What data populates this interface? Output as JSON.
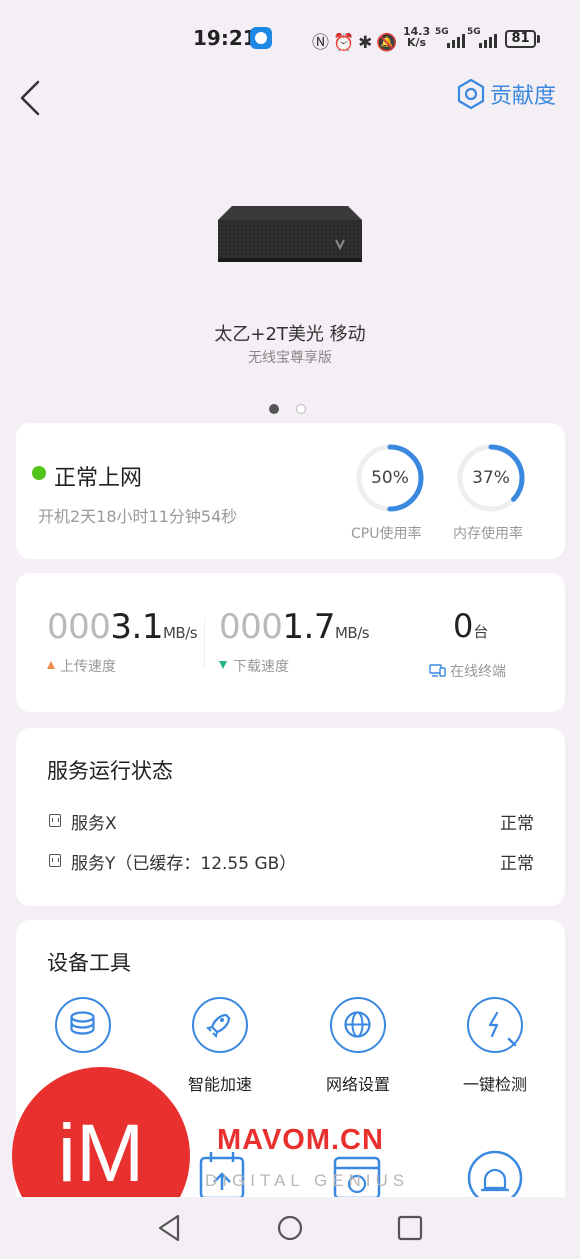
{
  "status_bar": {
    "time": "19:21",
    "net_speed_value": "14.3",
    "net_speed_unit": "K/s",
    "sig1": "5G",
    "sig2": "5G",
    "battery": "81",
    "icons": [
      "nfc-icon",
      "alarm-icon",
      "bluetooth-icon",
      "mute-icon"
    ]
  },
  "header": {
    "contribution_label": "贡献度"
  },
  "device": {
    "name": "太乙+2T美光 移动",
    "subtitle": "无线宝尊享版",
    "carousel_pages": 2,
    "carousel_active": 0
  },
  "status_card": {
    "status_text": "正常上网",
    "uptime": "开机2天18小时11分钟54秒",
    "cpu_value": "50%",
    "cpu_fraction": 0.5,
    "cpu_label": "CPU使用率",
    "mem_value": "37%",
    "mem_fraction": 0.37,
    "mem_label": "内存使用率",
    "accent": "#3a88e0"
  },
  "speed_card": {
    "upload_prefix": "000",
    "upload_value": "3.1",
    "upload_unit": "MB/s",
    "upload_label": "上传速度",
    "download_prefix": "000",
    "download_value": "1.7",
    "download_unit": "MB/s",
    "download_label": "下载速度",
    "devices_count": "0",
    "devices_unit": "台",
    "devices_label": "在线终端"
  },
  "services": {
    "title": "服务运行状态",
    "items": [
      {
        "name": "服务X",
        "status": "正常"
      },
      {
        "name": "服务Y（已缓存：12.55 GB）",
        "status": "正常"
      }
    ]
  },
  "tools": {
    "title": "设备工具",
    "items": [
      {
        "label": "",
        "icon": "storage-icon"
      },
      {
        "label": "智能加速",
        "icon": "rocket-icon"
      },
      {
        "label": "网络设置",
        "icon": "globe-icon"
      },
      {
        "label": "一键检测",
        "icon": "diagnose-icon"
      }
    ],
    "row2_icons": [
      "upload-box-icon",
      "schedule-icon",
      "alarm-light-icon"
    ]
  },
  "watermark": {
    "logo_text": "iM",
    "brand": "MAVOM.CN",
    "tagline": "DIGITAL GENIUS"
  }
}
